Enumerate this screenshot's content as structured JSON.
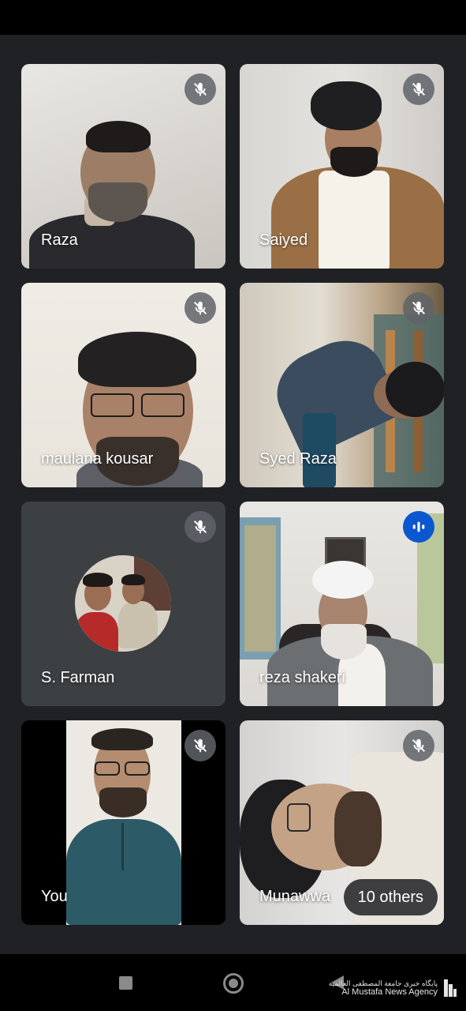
{
  "participants": [
    {
      "name": "Raza",
      "mic": "muted"
    },
    {
      "name": "Saiyed",
      "mic": "muted"
    },
    {
      "name": "maulana kousar",
      "mic": "muted"
    },
    {
      "name": "Syed Raza",
      "mic": "muted"
    },
    {
      "name": "S. Farman",
      "mic": "muted"
    },
    {
      "name": "reza shakeri",
      "mic": "speaking"
    },
    {
      "name": "You",
      "mic": "muted"
    },
    {
      "name": "Munawwa",
      "mic": "muted"
    }
  ],
  "others": {
    "label": "10 others"
  },
  "icons": {
    "mic_muted": "mic-off-icon",
    "speaking": "audio-level-icon",
    "nav_recents": "square-icon",
    "nav_home": "circle-icon",
    "nav_back": "triangle-back-icon"
  },
  "colors": {
    "background": "#202124",
    "tile": "#3c4043",
    "speaking_accent": "#0b57d0"
  },
  "watermark": {
    "arabic": "پایگاه خبری جامعة المصطفی العالمیه",
    "english": "Al Mustafa News Agency"
  }
}
